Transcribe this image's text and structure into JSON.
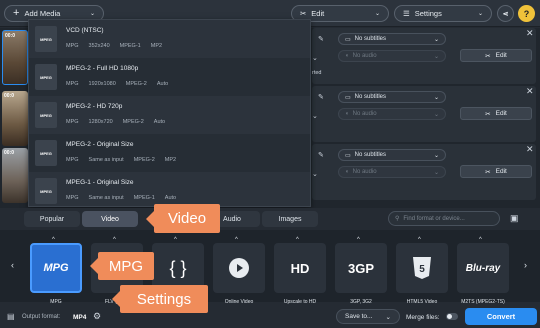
{
  "topbar": {
    "add_media": "Add Media",
    "edit": "Edit",
    "settings": "Settings",
    "help": "?"
  },
  "files": [
    {
      "time": "00:0",
      "subtitles": "No subtitles",
      "audio": "No audio",
      "edit": "Edit",
      "status": "rted"
    },
    {
      "time": "00:0",
      "subtitles": "No subtitles",
      "audio": "No audio",
      "edit": "Edit"
    },
    {
      "time": "00:0",
      "subtitles": "No subtitles",
      "audio": "No audio",
      "edit": "Edit"
    }
  ],
  "format_list": [
    {
      "icon": "mpg-file-icon",
      "title": "VCD (NTSC)",
      "details": [
        "MPG",
        "352x240",
        "MPEG-1",
        "MP2"
      ]
    },
    {
      "icon": "mpg-file-icon",
      "title": "MPEG-2 - Full HD 1080p",
      "details": [
        "MPG",
        "1920x1080",
        "MPEG-2",
        "Auto"
      ]
    },
    {
      "icon": "mpg-file-icon",
      "title": "MPEG-2 - HD 720p",
      "details": [
        "MPG",
        "1280x720",
        "MPEG-2",
        "Auto"
      ]
    },
    {
      "icon": "mpg-file-icon",
      "title": "MPEG-2 - Original Size",
      "details": [
        "MPG",
        "Same as input",
        "MPEG-2",
        "MP2"
      ]
    },
    {
      "icon": "mpg-file-icon",
      "title": "MPEG-1 - Original Size",
      "details": [
        "MPG",
        "Same as input",
        "MPEG-1",
        "Auto"
      ]
    }
  ],
  "tabs": [
    "Popular",
    "Video",
    "Audio",
    "Images"
  ],
  "search": {
    "placeholder": "Find format or device..."
  },
  "presets": [
    {
      "label": "MPG",
      "icon": "mpg-icon"
    },
    {
      "label": "FLV (Flash",
      "icon": "flv-icon"
    },
    {
      "label": "",
      "icon": "json-brace-icon"
    },
    {
      "label": "Online Video",
      "icon": "online-video-icon"
    },
    {
      "label": "Upscale to HD",
      "icon": "hd-icon"
    },
    {
      "label": "3GP, 3G2",
      "icon": "3gp-icon"
    },
    {
      "label": "HTML5 Video",
      "icon": "html5-icon"
    },
    {
      "label": "M2TS (MPEG2-TS)",
      "icon": "bluray-icon"
    }
  ],
  "bottom": {
    "output_label": "Output format:",
    "output_value": "MP4",
    "save_to": "Save to...",
    "merge_files": "Merge files:",
    "convert": "Convert"
  },
  "callouts": {
    "video": "Video",
    "mpg": "MPG",
    "settings": "Settings"
  },
  "colors": {
    "accent": "#2a8cf0",
    "callout": "#f08c5a",
    "help": "#f0c23a"
  }
}
